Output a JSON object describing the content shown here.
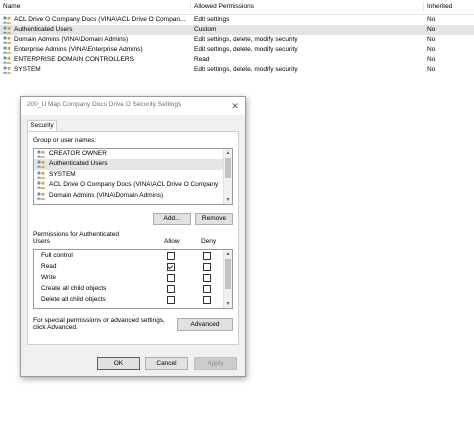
{
  "table": {
    "columns": {
      "name": "Name",
      "permissions": "Allowed Permissions",
      "inherited": "Inherited"
    },
    "rows": [
      {
        "name": "ACL Drive O Company Docs (VINA\\ACL Drive O Compan...",
        "permissions": "Edit settings",
        "inherited": "No",
        "selected": false
      },
      {
        "name": "Authenticated Users",
        "permissions": "Custom",
        "inherited": "No",
        "selected": true
      },
      {
        "name": "Domain Admins (VINA\\Domain Admins)",
        "permissions": "Edit settings, delete, modify security",
        "inherited": "No",
        "selected": false
      },
      {
        "name": "Enterprise Admins (VINA\\Enterprise Admins)",
        "permissions": "Edit settings, delete, modify security",
        "inherited": "No",
        "selected": false
      },
      {
        "name": "ENTERPRISE DOMAIN CONTROLLERS",
        "permissions": "Read",
        "inherited": "No",
        "selected": false
      },
      {
        "name": "SYSTEM",
        "permissions": "Edit settings, delete, modify security",
        "inherited": "No",
        "selected": false
      }
    ]
  },
  "dialog": {
    "title": "200_U Map Company Docs Drive O Security Settings",
    "close_icon": "close-icon",
    "tab_security": "Security",
    "group_label": "Group or user names:",
    "groups": [
      {
        "name": "CREATOR OWNER",
        "selected": false
      },
      {
        "name": "Authenticated Users",
        "selected": true
      },
      {
        "name": "SYSTEM",
        "selected": false
      },
      {
        "name": "ACL Drive O Company Docs (VINA\\ACL Drive O Company",
        "selected": false
      },
      {
        "name": "Domain Admins (VINA\\Domain Admins)",
        "selected": false
      }
    ],
    "add_button": "Add...",
    "remove_button": "Remove",
    "permissions_for_label_line1": "Permissions for Authenticated",
    "permissions_for_label_line2": "Users",
    "allow_header": "Allow",
    "deny_header": "Deny",
    "permissions": [
      {
        "name": "Full control",
        "allow": false,
        "deny": false
      },
      {
        "name": "Read",
        "allow": true,
        "deny": false
      },
      {
        "name": "Write",
        "allow": false,
        "deny": false
      },
      {
        "name": "Create all child objects",
        "allow": false,
        "deny": false
      },
      {
        "name": "Delete all child objects",
        "allow": false,
        "deny": false
      }
    ],
    "special_text_line1": "For special permissions or advanced settings,",
    "special_text_line2": "click Advanced.",
    "advanced_button": "Advanced",
    "ok_button": "OK",
    "cancel_button": "Cancel",
    "apply_button": "Apply"
  },
  "icons": {
    "user_group": "users-icon",
    "scroll_up": "chevron-up-icon",
    "scroll_down": "chevron-down-icon"
  },
  "colors": {
    "selection": "#e5e5e5",
    "dialog_bg": "#f0f0f0",
    "button_bg": "#e1e1e1",
    "default_button_border": "#0078d7"
  }
}
